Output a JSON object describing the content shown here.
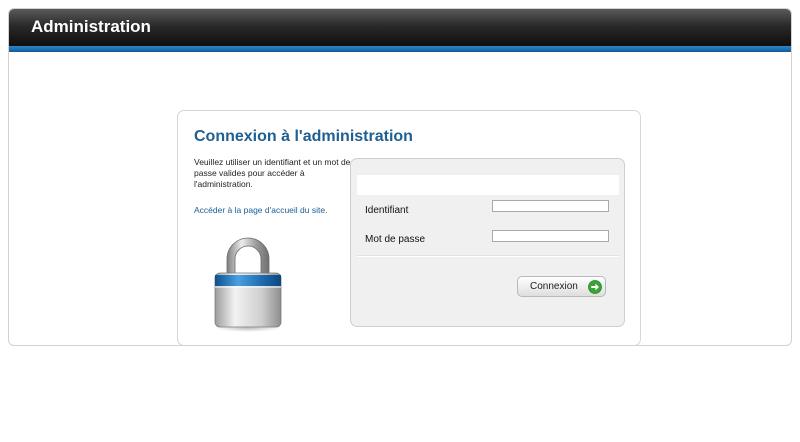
{
  "header": {
    "title": "Administration",
    "bar_color": "#1e1e1e",
    "stripe_color": "#1b6fb3"
  },
  "login": {
    "title": "Connexion à l'administration",
    "intro": "Veuillez utiliser un identifiant et un mot de passe valides pour accéder à l'administration.",
    "home_link": "Accéder à la page d'accueil du site.",
    "lock_icon": "padlock-icon"
  },
  "form": {
    "username_label": "Identifiant",
    "username_value": "",
    "password_label": "Mot de passe",
    "password_value": "",
    "submit_label": "Connexion",
    "submit_icon": "arrow-right-circle-icon",
    "accent_color": "#1f5f91",
    "submit_icon_color": "#3aa335"
  }
}
